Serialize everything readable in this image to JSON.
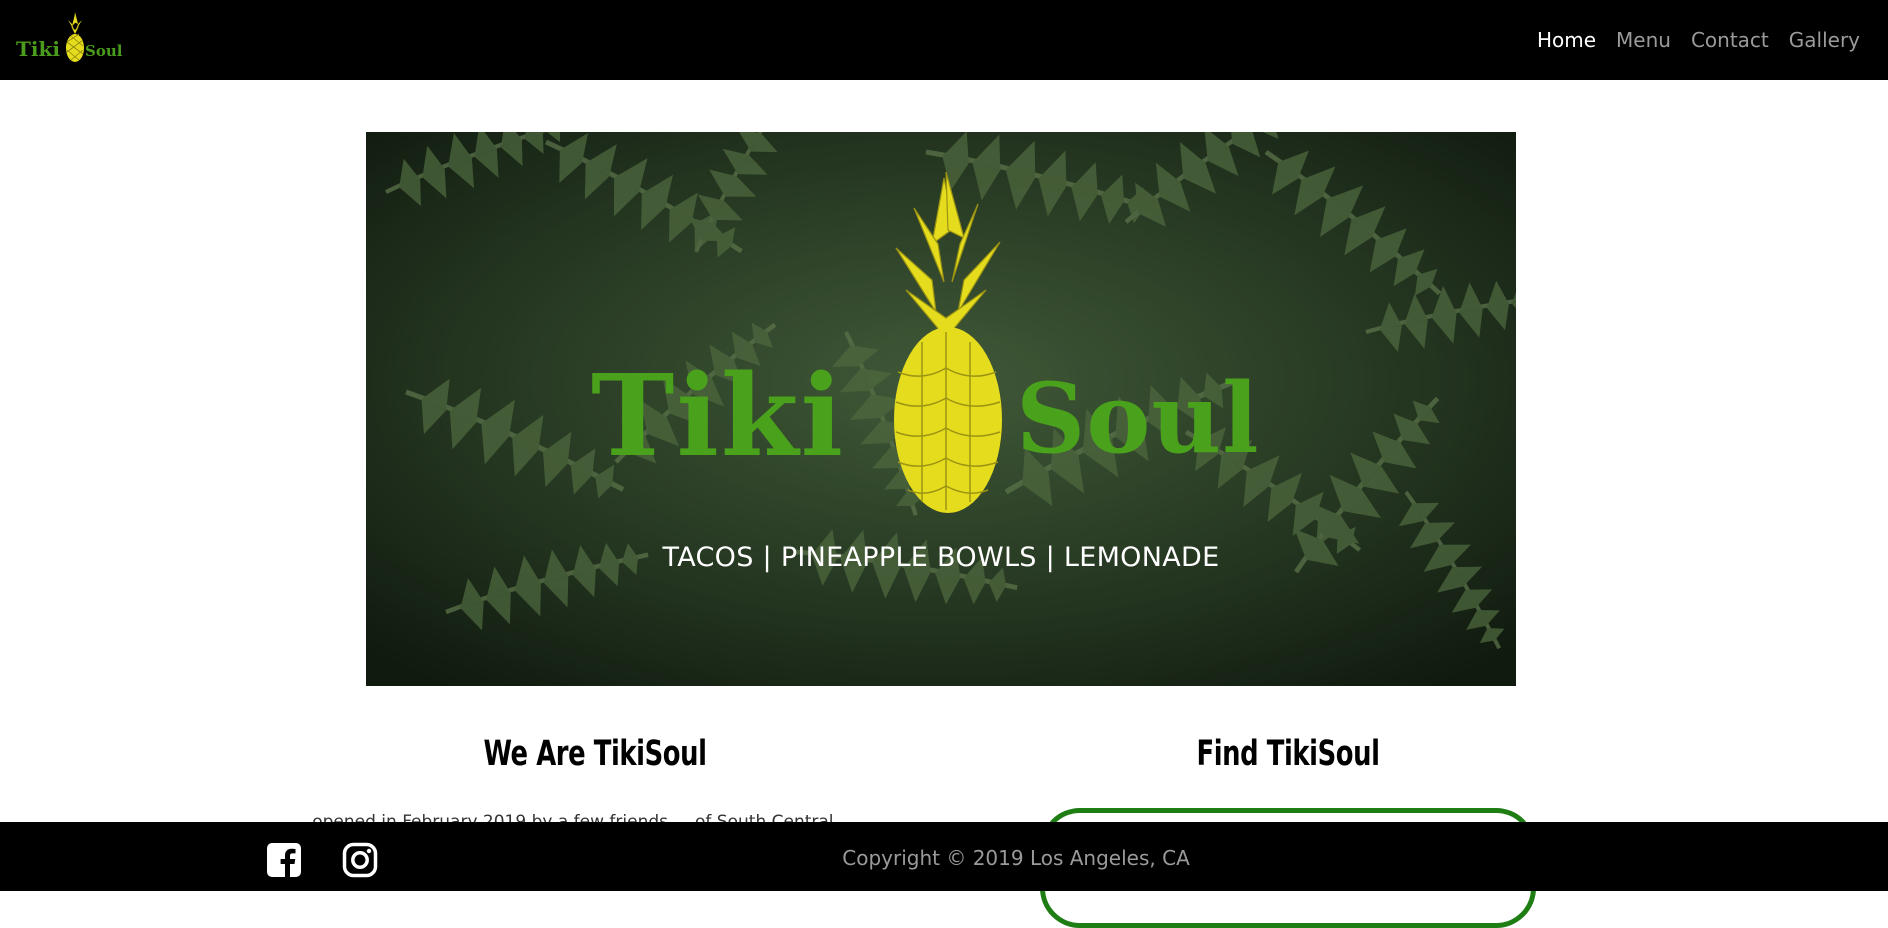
{
  "brand": {
    "logo_word_left": "Tiki",
    "logo_word_right": "Soul",
    "logo_icon": "pineapple-icon",
    "logo_green": "#4a9c1c",
    "logo_yellow": "#e6dc1e"
  },
  "nav": {
    "items": [
      {
        "label": "Home",
        "active": true
      },
      {
        "label": "Menu",
        "active": false
      },
      {
        "label": "Contact",
        "active": false
      },
      {
        "label": "Gallery",
        "active": false
      }
    ]
  },
  "hero": {
    "logo_word_left": "Tiki",
    "logo_word_right": "Soul",
    "tagline": "TACOS | PINEAPPLE BOWLS | LEMONADE"
  },
  "about": {
    "heading": "We Are TikiSoul",
    "text": "...opened in February 2019 by a few friends ... of South Central ..."
  },
  "find": {
    "heading": "Find TikiSoul"
  },
  "footer": {
    "social": [
      {
        "name": "facebook-icon"
      },
      {
        "name": "instagram-icon"
      }
    ],
    "copyright": "Copyright © 2019 Los Angeles, CA"
  },
  "colors": {
    "navbar_bg": "#000000",
    "nav_active": "#ffffff",
    "nav_inactive": "#9a9a9a",
    "map_border": "#1e7d13"
  }
}
